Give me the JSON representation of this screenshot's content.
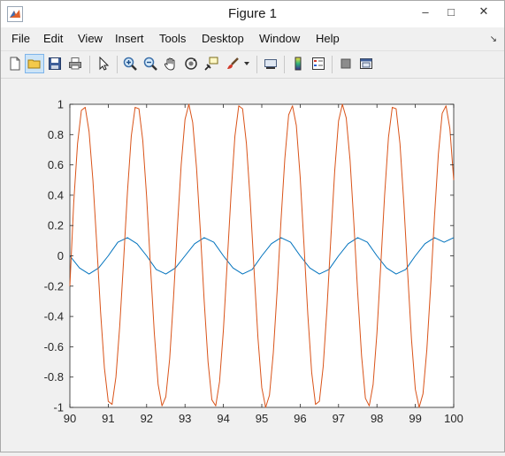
{
  "window": {
    "title": "Figure 1",
    "controls": {
      "minimize": "–",
      "maximize": "□",
      "close": "✕"
    }
  },
  "menu": {
    "items": [
      "File",
      "Edit",
      "View",
      "Insert",
      "Tools",
      "Desktop",
      "Window",
      "Help"
    ],
    "dock_icon": "↘"
  },
  "toolbar": {
    "buttons": [
      {
        "name": "new-figure-icon"
      },
      {
        "name": "open-file-icon",
        "active": true
      },
      {
        "name": "save-icon"
      },
      {
        "name": "print-icon"
      },
      {
        "name": "edit-plot-arrow-icon"
      },
      {
        "name": "zoom-in-icon"
      },
      {
        "name": "zoom-out-icon"
      },
      {
        "name": "pan-hand-icon"
      },
      {
        "name": "rotate-3d-icon"
      },
      {
        "name": "data-cursor-icon"
      },
      {
        "name": "brush-icon"
      },
      {
        "name": "brush-dropdown-icon"
      },
      {
        "name": "link-plot-icon"
      },
      {
        "name": "insert-colorbar-icon"
      },
      {
        "name": "insert-legend-icon"
      },
      {
        "name": "hide-plot-tools-icon"
      },
      {
        "name": "show-plot-tools-icon"
      }
    ]
  },
  "chart_data": {
    "type": "line",
    "xlim": [
      90,
      100
    ],
    "ylim": [
      -1,
      1
    ],
    "x_ticks": [
      90,
      91,
      92,
      93,
      94,
      95,
      96,
      97,
      98,
      99,
      100
    ],
    "y_ticks": [
      1,
      0.8,
      0.6,
      0.4,
      0.2,
      0,
      -0.2,
      -0.4,
      -0.6,
      -0.8,
      -1
    ],
    "y_tick_labels": [
      "1",
      "0.8",
      "0.6",
      "0.4",
      "0.2",
      "0",
      "-0.2",
      "-0.4",
      "-0.6",
      "-0.8",
      "-1"
    ],
    "x_tick_labels": [
      "90",
      "91",
      "92",
      "93",
      "94",
      "95",
      "96",
      "97",
      "98",
      "99",
      "100"
    ],
    "grid": false,
    "series": [
      {
        "color": "#0072BD",
        "x": [
          90,
          90.25,
          90.5,
          90.75,
          91,
          91.25,
          91.5,
          91.75,
          92,
          92.25,
          92.5,
          92.75,
          93,
          93.25,
          93.5,
          93.75,
          94,
          94.25,
          94.5,
          94.75,
          95,
          95.25,
          95.5,
          95.75,
          96,
          96.25,
          96.5,
          96.75,
          97,
          97.25,
          97.5,
          97.75,
          98,
          98.25,
          98.5,
          98.75,
          99,
          99.25,
          99.5,
          99.75,
          100
        ],
        "y": [
          0,
          -0.08,
          -0.12,
          -0.08,
          0,
          0.09,
          0.12,
          0.08,
          0,
          -0.09,
          -0.12,
          -0.08,
          0,
          0.08,
          0.12,
          0.09,
          0,
          -0.08,
          -0.12,
          -0.09,
          0,
          0.08,
          0.12,
          0.09,
          0,
          -0.08,
          -0.12,
          -0.09,
          0,
          0.08,
          0.12,
          0.09,
          0,
          -0.08,
          -0.12,
          -0.09,
          0,
          0.08,
          0.12,
          0.09,
          0.12
        ]
      },
      {
        "color": "#D95319",
        "x": [
          90,
          90.1,
          90.2,
          90.3,
          90.4,
          90.5,
          90.6,
          90.7,
          90.8,
          90.9,
          91,
          91.1,
          91.2,
          91.3,
          91.4,
          91.5,
          91.6,
          91.7,
          91.8,
          91.9,
          92,
          92.1,
          92.2,
          92.3,
          92.4,
          92.5,
          92.6,
          92.7,
          92.8,
          92.9,
          93,
          93.1,
          93.2,
          93.3,
          93.4,
          93.5,
          93.6,
          93.7,
          93.8,
          93.9,
          94,
          94.1,
          94.2,
          94.3,
          94.4,
          94.5,
          94.6,
          94.7,
          94.8,
          94.9,
          95,
          95.1,
          95.2,
          95.3,
          95.4,
          95.5,
          95.6,
          95.7,
          95.8,
          95.9,
          96,
          96.1,
          96.2,
          96.3,
          96.4,
          96.5,
          96.6,
          96.7,
          96.8,
          96.9,
          97,
          97.1,
          97.2,
          97.3,
          97.4,
          97.5,
          97.6,
          97.7,
          97.8,
          97.9,
          98,
          98.1,
          98.2,
          98.3,
          98.4,
          98.5,
          98.6,
          98.7,
          98.8,
          98.9,
          99,
          99.1,
          99.2,
          99.3,
          99.4,
          99.5,
          99.6,
          99.7,
          99.8,
          99.9,
          100
        ],
        "y": [
          -0.2,
          0.35,
          0.74,
          0.96,
          0.98,
          0.82,
          0.5,
          0.08,
          -0.37,
          -0.74,
          -0.96,
          -0.98,
          -0.8,
          -0.46,
          -0.03,
          0.42,
          0.79,
          0.98,
          0.97,
          0.76,
          0.39,
          -0.07,
          -0.51,
          -0.85,
          -0.99,
          -0.93,
          -0.68,
          -0.28,
          0.18,
          0.6,
          0.9,
          1.0,
          0.88,
          0.58,
          0.16,
          -0.3,
          -0.7,
          -0.95,
          -0.99,
          -0.83,
          -0.49,
          -0.04,
          0.41,
          0.79,
          0.99,
          0.97,
          0.74,
          0.36,
          -0.1,
          -0.54,
          -0.87,
          -1.0,
          -0.92,
          -0.64,
          -0.23,
          0.23,
          0.64,
          0.93,
          0.99,
          0.86,
          0.52,
          0.07,
          -0.39,
          -0.77,
          -0.98,
          -0.96,
          -0.73,
          -0.34,
          0.12,
          0.56,
          0.89,
          1.0,
          0.91,
          0.63,
          0.21,
          -0.25,
          -0.66,
          -0.94,
          -0.99,
          -0.85,
          -0.51,
          -0.06,
          0.4,
          0.78,
          0.98,
          0.97,
          0.74,
          0.35,
          -0.11,
          -0.55,
          -0.88,
          -1.0,
          -0.91,
          -0.62,
          -0.2,
          0.26,
          0.67,
          0.94,
          0.99,
          0.84,
          0.5
        ]
      }
    ]
  }
}
